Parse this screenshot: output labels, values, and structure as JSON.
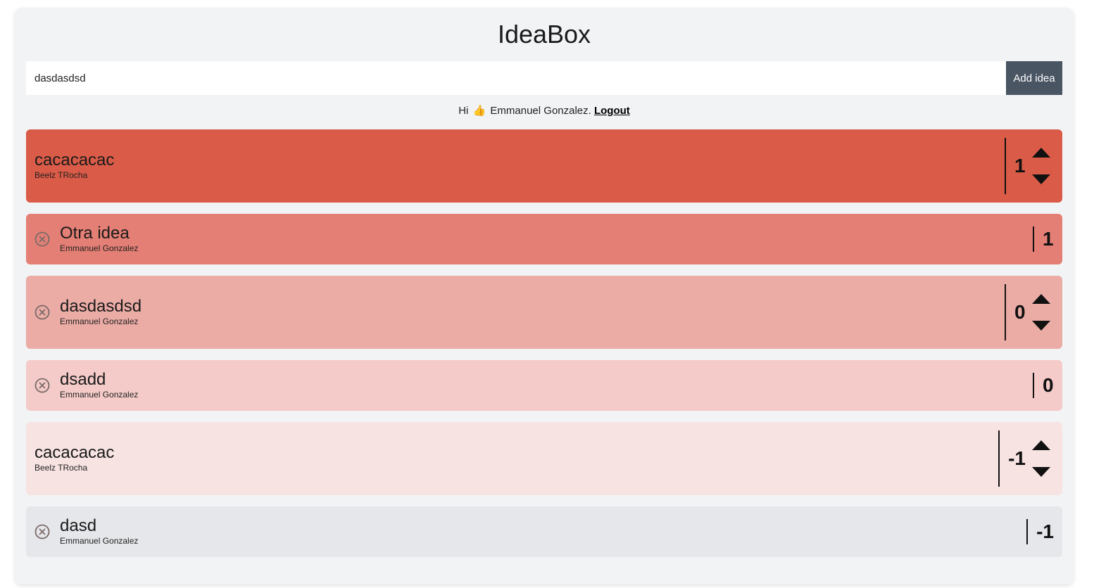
{
  "app": {
    "title": "IdeaBox"
  },
  "form": {
    "input_value": "dasdasdsd",
    "add_label": "Add idea"
  },
  "greeting": {
    "prefix": "Hi",
    "emoji": "👍",
    "user": "Emmanuel Gonzalez.",
    "logout_label": "Logout"
  },
  "colors": {
    "app_bg": "#f2f3f5",
    "button_bg": "#4a5563",
    "idea_bg": [
      "#da5b48",
      "#e47f75",
      "#ecaca6",
      "#f4cbc8",
      "#f7e3e2",
      "#e6e7ea"
    ]
  },
  "ideas": [
    {
      "title": "cacacacac",
      "author": "Beelz TRocha",
      "votes": "1",
      "removable": false,
      "votable": true
    },
    {
      "title": "Otra idea",
      "author": "Emmanuel Gonzalez",
      "votes": "1",
      "removable": true,
      "votable": false
    },
    {
      "title": "dasdasdsd",
      "author": "Emmanuel Gonzalez",
      "votes": "0",
      "removable": true,
      "votable": true
    },
    {
      "title": "dsadd",
      "author": "Emmanuel Gonzalez",
      "votes": "0",
      "removable": true,
      "votable": false
    },
    {
      "title": "cacacacac",
      "author": "Beelz TRocha",
      "votes": "-1",
      "removable": false,
      "votable": true
    },
    {
      "title": "dasd",
      "author": "Emmanuel Gonzalez",
      "votes": "-1",
      "removable": true,
      "votable": false
    }
  ],
  "icons": {
    "remove": "close-circle-icon",
    "upvote": "caret-up-icon",
    "downvote": "caret-down-icon"
  }
}
